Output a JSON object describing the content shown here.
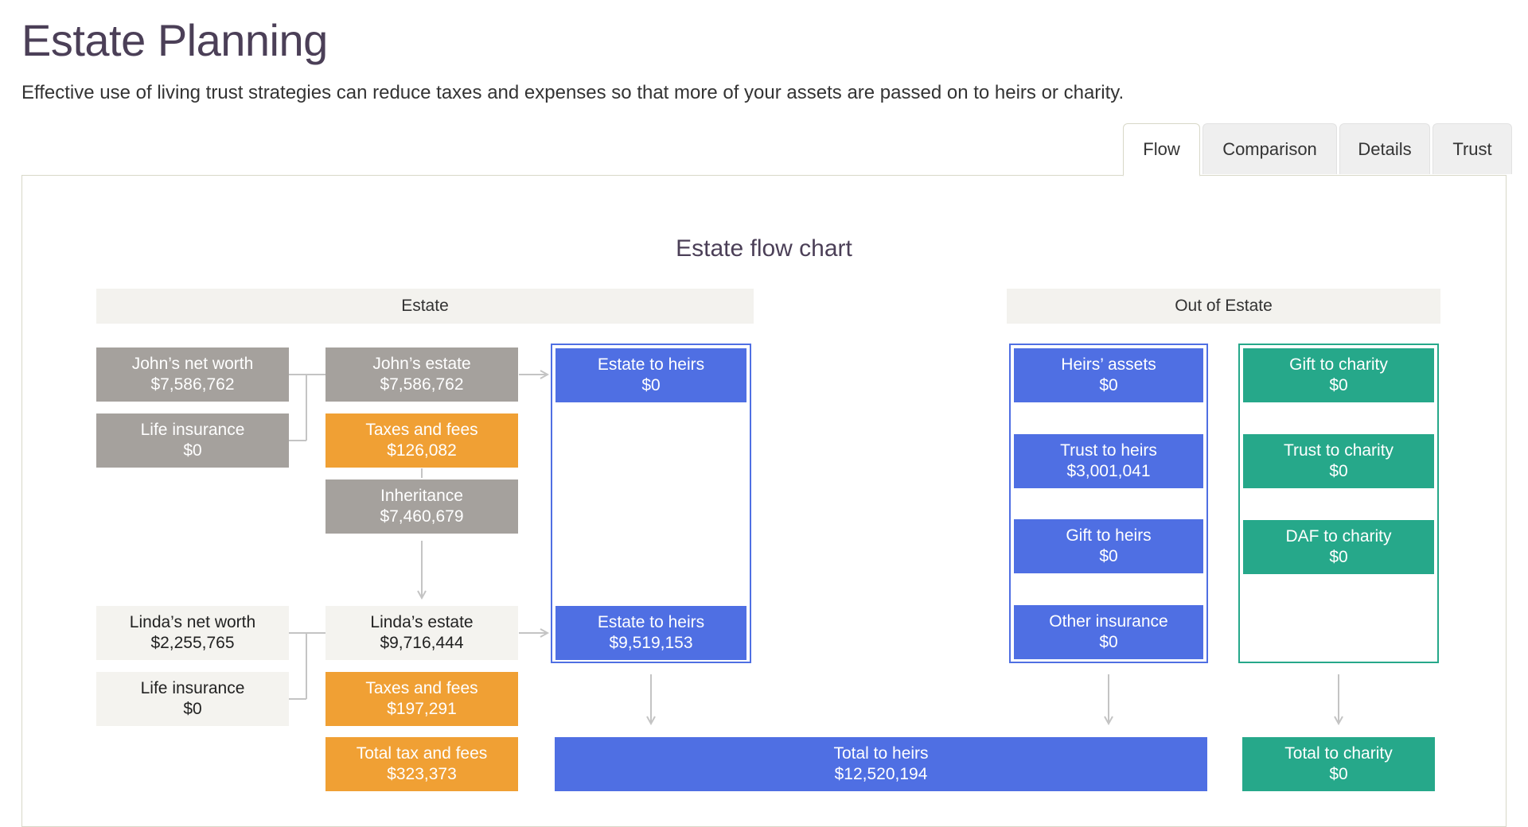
{
  "page": {
    "title": "Estate Planning",
    "description": "Effective use of living trust strategies can reduce taxes and expenses so that more of your assets are passed on to heirs or charity."
  },
  "tabs": [
    {
      "label": "Flow",
      "active": true
    },
    {
      "label": "Comparison",
      "active": false
    },
    {
      "label": "Details",
      "active": false
    },
    {
      "label": "Trust",
      "active": false
    }
  ],
  "chart": {
    "title": "Estate flow chart",
    "sections": {
      "estate": "Estate",
      "out_of_estate": "Out of Estate"
    },
    "nodes": {
      "john_net_worth": {
        "label": "John’s net worth",
        "value": "$7,586,762"
      },
      "john_life_insurance": {
        "label": "Life insurance",
        "value": "$0"
      },
      "john_estate": {
        "label": "John’s estate",
        "value": "$7,586,762"
      },
      "john_taxes": {
        "label": "Taxes and fees",
        "value": "$126,082"
      },
      "inheritance": {
        "label": "Inheritance",
        "value": "$7,460,679"
      },
      "john_estate_to_heirs": {
        "label": "Estate to heirs",
        "value": "$0"
      },
      "linda_net_worth": {
        "label": "Linda’s net worth",
        "value": "$2,255,765"
      },
      "linda_life_insurance": {
        "label": "Life insurance",
        "value": "$0"
      },
      "linda_estate": {
        "label": "Linda’s estate",
        "value": "$9,716,444"
      },
      "linda_taxes": {
        "label": "Taxes and fees",
        "value": "$197,291"
      },
      "linda_estate_to_heirs": {
        "label": "Estate to heirs",
        "value": "$9,519,153"
      },
      "total_tax": {
        "label": "Total tax and fees",
        "value": "$323,373"
      },
      "total_heirs": {
        "label": "Total to heirs",
        "value": "$12,520,194"
      },
      "heirs_assets": {
        "label": "Heirs’ assets",
        "value": "$0"
      },
      "trust_heirs": {
        "label": "Trust to heirs",
        "value": "$3,001,041"
      },
      "gift_heirs": {
        "label": "Gift to heirs",
        "value": "$0"
      },
      "other_insurance": {
        "label": "Other insurance",
        "value": "$0"
      },
      "gift_charity": {
        "label": "Gift to charity",
        "value": "$0"
      },
      "trust_charity": {
        "label": "Trust to charity",
        "value": "$0"
      },
      "daf_charity": {
        "label": "DAF to charity",
        "value": "$0"
      },
      "total_charity": {
        "label": "Total to charity",
        "value": "$0"
      }
    }
  },
  "colors": {
    "gray": "#a5a19d",
    "light": "#f4f3ef",
    "orange": "#f0a034",
    "blue": "#4f6fe3",
    "green": "#26a88a",
    "title": "#4b3f57"
  }
}
